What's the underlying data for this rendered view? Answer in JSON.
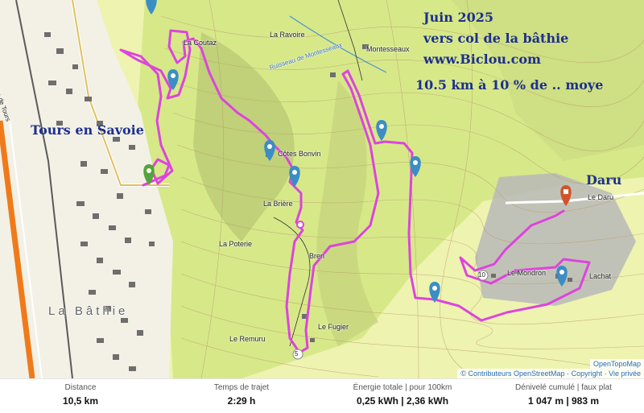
{
  "overlay": {
    "line1": "Juin 2025",
    "line2": "vers col de la bâthie",
    "line3": "www.Biclou.com",
    "line4": "10.5 km à 10 % de .. moye",
    "town_label": "Tours en Savoie",
    "daru_label": "Daru"
  },
  "places": {
    "coutaz": "La Coutaz",
    "ravoire": "La Ravoire",
    "montesseaux": "Montesseaux",
    "ruisseau": "Ruisseau de Montesseaux",
    "cotes_bonvin": "Côtes Bonvin",
    "briere": "La Brière",
    "poterie": "La Poterie",
    "bren": "Bren",
    "fugier": "Le Fugier",
    "remuru": "Le Remuru",
    "mondron": "Le Mondron",
    "lachat": "Lachat",
    "le_daru": "Le Daru",
    "la_bathie": "La Bâthie",
    "route": "Route de Tours",
    "km5": "5",
    "km10": "10"
  },
  "attribution": {
    "provider": "OpenTopoMap",
    "contributors": "© Contributeurs OpenStreetMap",
    "copyright": "Copyright",
    "privacy": "Vie privée",
    "sep": "·"
  },
  "colors": {
    "route": "#dd44dd",
    "waypoint": "#3b8ec4",
    "start_marker": "#55a33a",
    "end_marker": "#d2542a",
    "title_text": "#1d2f8f",
    "terrain_light": "#eef3b0",
    "terrain_mid": "#d7e889",
    "terrain_dark": "#b6c772",
    "rock": "#b9b9b9"
  },
  "stats": [
    {
      "label": "Distance",
      "value": "10,5 km"
    },
    {
      "label": "Temps de trajet",
      "value": "2:29 h"
    },
    {
      "label": "Énergie totale | pour 100km",
      "value": "0,25 kWh | 2,36 kWh"
    },
    {
      "label": "Dénivelé cumulé | faux plat",
      "value": "1 047 m | 983 m"
    }
  ]
}
